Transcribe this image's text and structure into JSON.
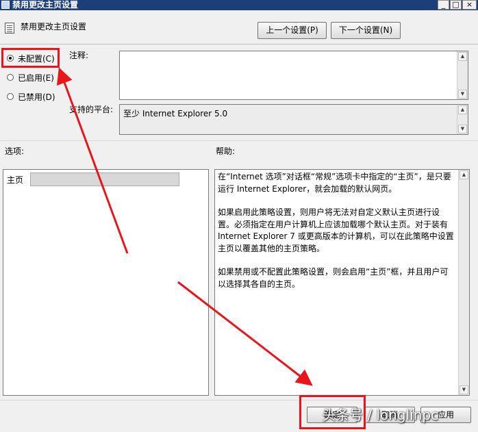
{
  "window": {
    "title": "禁用更改主页设置",
    "controls": [
      "_",
      "□",
      "×"
    ]
  },
  "header": {
    "title": "禁用更改主页设置",
    "prev_button": "上一个设置(P)",
    "next_button": "下一个设置(N)"
  },
  "state": {
    "options": [
      {
        "label": "未配置(C)",
        "selected": true
      },
      {
        "label": "已启用(E)",
        "selected": false
      },
      {
        "label": "已禁用(D)",
        "selected": false
      }
    ]
  },
  "comment": {
    "label": "注释:",
    "value": ""
  },
  "platform": {
    "label": "支持的平台:",
    "value": "至少 Internet Explorer 5.0"
  },
  "options_section": {
    "label": "选项:",
    "homepage_label": "主页",
    "homepage_value": ""
  },
  "help_section": {
    "label": "帮助:",
    "paragraphs": [
      "在“Internet 选项”对话框“常规”选项卡中指定的“主页”，是只要运行 Internet Explorer，就会加载的默认网页。",
      "如果启用此策略设置，则用户将无法对自定义默认主页进行设置。必须指定在用户计算机上应该加载哪个默认主页。对于装有 Internet Explorer 7 或更高版本的计算机，可以在此策略中设置主页以覆盖其他的主页策略。",
      "如果禁用或不配置此策略设置，则会启用“主页”框，并且用户可以选择其各自的主页。"
    ]
  },
  "footer": {
    "ok_button": "确定",
    "cancel_button": "取消",
    "apply_button": "应用"
  },
  "watermark": "头条号 / longlinpc",
  "annotation_color": "#e8161b"
}
